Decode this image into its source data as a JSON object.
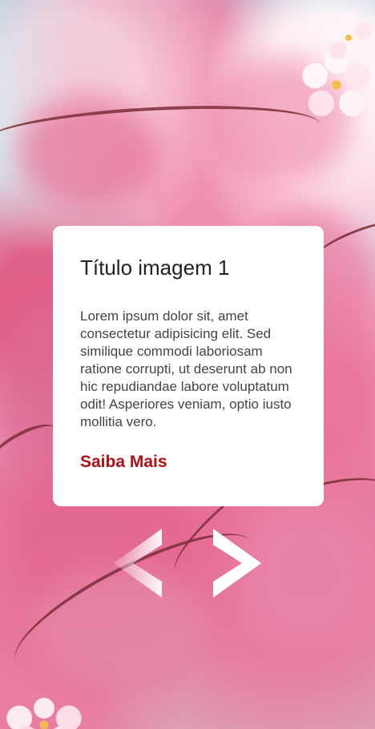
{
  "slide": {
    "title": "Título imagem 1",
    "description": "Lorem ipsum dolor sit, amet consectetur adipisicing elit. Sed similique commodi laboriosam ratione corrupti, ut deserunt ab non hic repudiandae labore voluptatum odit! Asperiores veniam, optio iusto mollitia vero.",
    "link_label": "Saiba Mais"
  },
  "controls": {
    "prev_icon": "chevron-left-icon",
    "next_icon": "chevron-right-icon"
  },
  "colors": {
    "card_bg": "#ffffff",
    "title": "#222222",
    "text": "#444444",
    "link": "#b10f14"
  }
}
